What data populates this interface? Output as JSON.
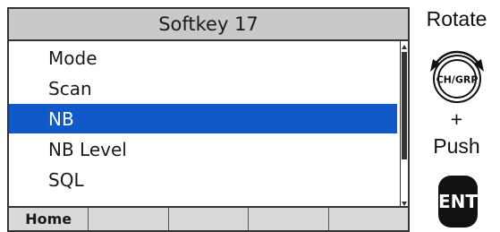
{
  "screen": {
    "title": "Softkey 17",
    "menu_items": [
      {
        "label": "Mode",
        "selected": false
      },
      {
        "label": "Scan",
        "selected": false
      },
      {
        "label": "NB",
        "selected": true
      },
      {
        "label": "NB Level",
        "selected": false
      },
      {
        "label": "SQL",
        "selected": false
      }
    ],
    "softkeys": [
      "Home",
      "",
      "",
      "",
      ""
    ]
  },
  "controls": {
    "rotate_label": "Rotate",
    "knob_label": "CH/GRP",
    "plus": "+",
    "push_label": "Push",
    "ent_label": "ENT"
  },
  "colors": {
    "selection": "#1158c8",
    "title_bar": "#c9c9c9",
    "softkey_bar": "#d9d9d9"
  }
}
